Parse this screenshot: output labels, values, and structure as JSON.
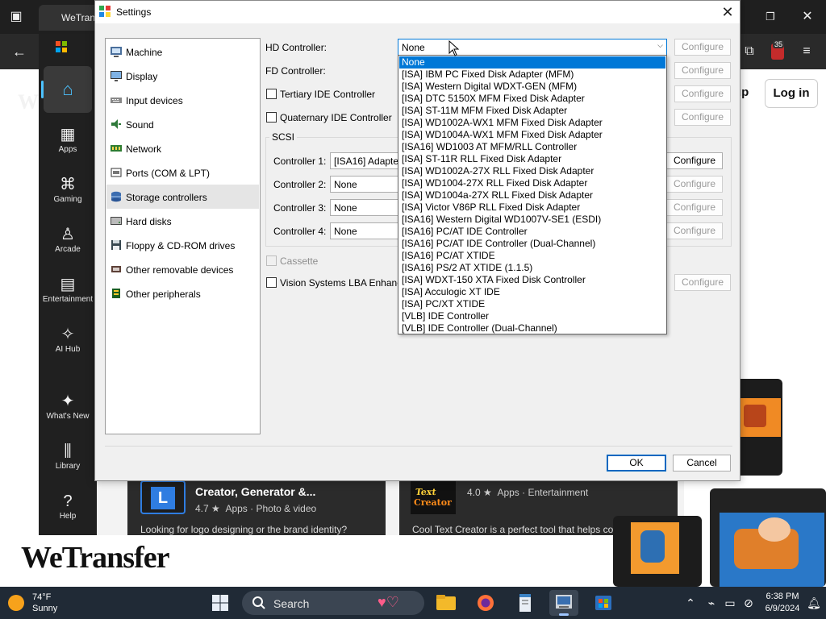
{
  "browser": {
    "tab_title": "WeTran",
    "notification_badge": "35",
    "buttons": {
      "signup_partial": "up",
      "login": "Log in"
    },
    "brand_logo": "WeTransfer"
  },
  "store": {
    "rail": [
      {
        "label": "",
        "icon": "home-icon"
      },
      {
        "label": "Apps",
        "icon": "apps-icon"
      },
      {
        "label": "Gaming",
        "icon": "gamepad-icon"
      },
      {
        "label": "Arcade",
        "icon": "joystick-icon"
      },
      {
        "label": "Entertainment",
        "icon": "film-icon"
      },
      {
        "label": "AI Hub",
        "icon": "sparkle-icon"
      },
      {
        "label": "What's New",
        "icon": "party-icon"
      },
      {
        "label": "Library",
        "icon": "library-icon"
      },
      {
        "label": "Help",
        "icon": "help-icon"
      }
    ],
    "cards": [
      {
        "title": "Creator, Generator &...",
        "rating": "4.7 ★",
        "meta": "Apps  ·  Photo & video",
        "desc": "Looking for logo designing or the brand identity?"
      },
      {
        "title": "",
        "rating": "4.0 ★",
        "meta": "Apps  ·  Entertainment",
        "desc": "Cool Text Creator is a perfect tool that helps convert"
      }
    ]
  },
  "dialog": {
    "title": "Settings",
    "categories": [
      {
        "label": "Machine",
        "icon": "machine-icon"
      },
      {
        "label": "Display",
        "icon": "display-icon"
      },
      {
        "label": "Input devices",
        "icon": "keyboard-icon"
      },
      {
        "label": "Sound",
        "icon": "speaker-icon"
      },
      {
        "label": "Network",
        "icon": "network-icon"
      },
      {
        "label": "Ports (COM & LPT)",
        "icon": "port-icon"
      },
      {
        "label": "Storage controllers",
        "icon": "storage-icon",
        "selected": true
      },
      {
        "label": "Hard disks",
        "icon": "hard-disk-icon"
      },
      {
        "label": "Floppy & CD-ROM drives",
        "icon": "floppy-icon"
      },
      {
        "label": "Other removable devices",
        "icon": "removable-icon"
      },
      {
        "label": "Other peripherals",
        "icon": "peripheral-icon"
      }
    ],
    "hd_controller": {
      "label": "HD Controller:",
      "value": "None"
    },
    "fd_controller": {
      "label": "FD Controller:"
    },
    "tertiary_ide": {
      "label": "Tertiary IDE Controller",
      "checked": false
    },
    "quaternary_ide": {
      "label": "Quaternary IDE Controller",
      "checked": false
    },
    "scsi": {
      "title": "SCSI",
      "controllers": [
        {
          "label": "Controller 1:",
          "value": "[ISA16] Adapte"
        },
        {
          "label": "Controller 2:",
          "value": "None"
        },
        {
          "label": "Controller 3:",
          "value": "None"
        },
        {
          "label": "Controller 4:",
          "value": "None"
        }
      ]
    },
    "cassette": {
      "label": "Cassette",
      "checked": false
    },
    "vision_lba": {
      "label": "Vision Systems LBA Enhanc",
      "checked": false
    },
    "configure_label": "Configure",
    "ok_label": "OK",
    "cancel_label": "Cancel",
    "hd_options": [
      "None",
      "[ISA] IBM PC Fixed Disk Adapter (MFM)",
      "[ISA] Western Digital WDXT-GEN (MFM)",
      "[ISA] DTC 5150X MFM Fixed Disk Adapter",
      "[ISA] ST-11M MFM Fixed Disk Adapter",
      "[ISA] WD1002A-WX1 MFM Fixed Disk Adapter",
      "[ISA] WD1004A-WX1 MFM Fixed Disk Adapter",
      "[ISA16] WD1003 AT MFM/RLL Controller",
      "[ISA] ST-11R RLL Fixed Disk Adapter",
      "[ISA] WD1002A-27X RLL Fixed Disk Adapter",
      "[ISA] WD1004-27X RLL Fixed Disk Adapter",
      "[ISA] WD1004a-27X RLL Fixed Disk Adapter",
      "[ISA] Victor V86P RLL Fixed Disk Adapter",
      "[ISA16] Western Digital WD1007V-SE1 (ESDI)",
      "[ISA16] PC/AT IDE Controller",
      "[ISA16] PC/AT IDE Controller (Dual-Channel)",
      "[ISA16] PC/AT XTIDE",
      "[ISA16] PS/2 AT XTIDE (1.1.5)",
      "[ISA] WDXT-150 XTA Fixed Disk Controller",
      "[ISA] Acculogic XT IDE",
      "[ISA] PC/XT XTIDE",
      "[VLB] IDE Controller",
      "[VLB] IDE Controller (Dual-Channel)"
    ]
  },
  "taskbar": {
    "weather": {
      "temp": "74°F",
      "desc": "Sunny"
    },
    "search_placeholder": "Search",
    "time": "6:38 PM",
    "date": "6/9/2024"
  }
}
